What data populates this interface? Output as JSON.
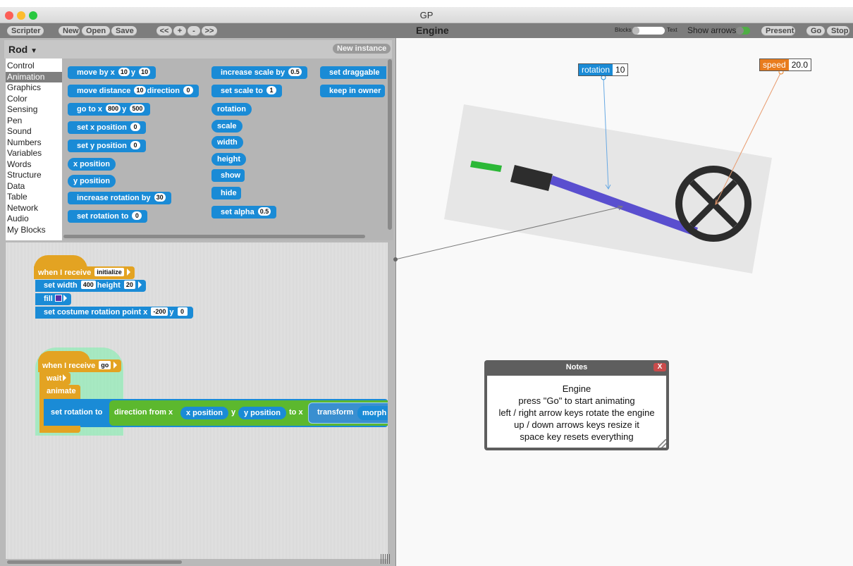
{
  "window": {
    "title": "GP"
  },
  "toolbar": {
    "scripter": "Scripter",
    "new": "New",
    "open": "Open",
    "save": "Save",
    "rewind": "<<",
    "zoom_in": "+",
    "zoom_out": "-",
    "forward": ">>",
    "project_title": "Engine",
    "blocks_label": "Blocks",
    "text_label": "Text",
    "show_arrows": "Show arrows:",
    "present": "Present",
    "go": "Go",
    "stop": "Stop"
  },
  "palette": {
    "sprite_name": "Rod",
    "new_instance": "New instance",
    "categories": [
      "Control",
      "Animation",
      "Graphics",
      "Color",
      "Sensing",
      "Pen",
      "Sound",
      "Numbers",
      "Variables",
      "Words",
      "Structure",
      "Data",
      "Table",
      "Network",
      "Audio",
      "My Blocks"
    ],
    "selected_category": "Animation",
    "blocks": {
      "move_by": {
        "pre": "move by x",
        "x": "10",
        "mid": "y",
        "y": "10"
      },
      "move_distance": {
        "pre": "move distance",
        "d": "10",
        "mid": "direction",
        "dir": "0"
      },
      "go_to": {
        "pre": "go to x",
        "x": "800",
        "mid": "y",
        "y": "500"
      },
      "set_x": {
        "pre": "set x position",
        "v": "0"
      },
      "set_y": {
        "pre": "set y position",
        "v": "0"
      },
      "x_position": "x position",
      "y_position": "y position",
      "increase_rotation": {
        "pre": "increase rotation by",
        "v": "30"
      },
      "set_rotation": {
        "pre": "set rotation to",
        "v": "0"
      },
      "increase_scale": {
        "pre": "increase scale by",
        "v": "0.5"
      },
      "set_scale": {
        "pre": "set scale to",
        "v": "1"
      },
      "rotation": "rotation",
      "scale": "scale",
      "width": "width",
      "height": "height",
      "show": "show",
      "hide": "hide",
      "set_alpha": {
        "pre": "set alpha",
        "v": "0.5"
      },
      "set_draggable": "set draggable",
      "keep_in_owner": "keep in owner"
    }
  },
  "scripts": {
    "script1": {
      "hat": "when I receive",
      "event": "initialize",
      "set_width": {
        "pre": "set width",
        "w": "400",
        "mid": "height",
        "h": "20"
      },
      "fill": "fill",
      "rotation_point": {
        "pre": "set costume rotation point x",
        "x": "-200",
        "mid": "y",
        "y": "0"
      }
    },
    "script2": {
      "hat": "when I receive",
      "event": "go",
      "wait": "wait",
      "animate": "animate",
      "set_rotation": "set rotation to",
      "direction_from": "direction from x",
      "x_position": "x position",
      "y_label": "y",
      "y_position": "y position",
      "to_x": "to x",
      "transform": "transform",
      "morph": "morph"
    }
  },
  "stage": {
    "rotation_watcher": {
      "label": "rotation",
      "value": "10"
    },
    "speed_watcher": {
      "label": "speed",
      "value": "20.0"
    },
    "notes": {
      "title": "Notes",
      "close": "X",
      "lines": [
        "Engine",
        "press \"Go\" to start animating",
        "left / right arrow keys rotate the engine",
        "up / down arrows keys resize it",
        "space key resets everything"
      ]
    }
  },
  "colors": {
    "motion_block": "#1a8bd6",
    "event_block": "#e3a322",
    "operator_block": "#5cb82e",
    "rod": "#5a4fcf",
    "speed_watcher": "#e87c1e"
  }
}
